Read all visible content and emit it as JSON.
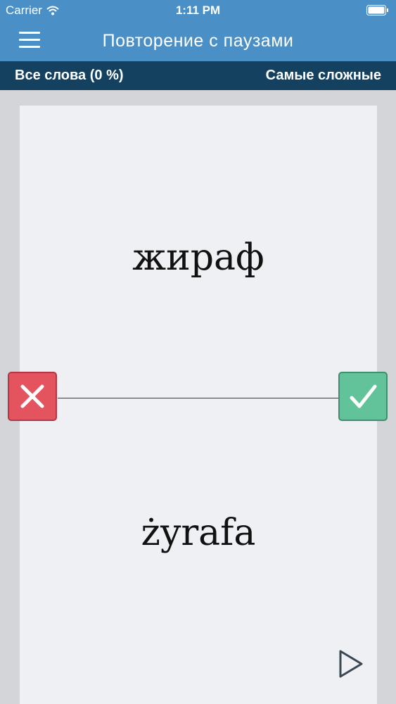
{
  "status_bar": {
    "carrier": "Carrier",
    "time": "1:11 PM",
    "icons": [
      "wifi-icon",
      "battery-icon"
    ]
  },
  "nav": {
    "title": "Повторение с паузами",
    "menu_icon": "hamburger-menu-icon"
  },
  "filter": {
    "left": "Все слова (0 %)",
    "right": "Самые сложные"
  },
  "card": {
    "front": "жираф",
    "back": "żyrafa"
  },
  "actions": {
    "wrong_icon": "x-icon",
    "right_icon": "check-icon",
    "play_icon": "play-icon"
  },
  "colors": {
    "header": "#4a8fc6",
    "subheader": "#13415f",
    "wrong": "#e4545f",
    "right": "#62c29a",
    "card": "#eef0f3",
    "background": "#d3d5d8"
  }
}
